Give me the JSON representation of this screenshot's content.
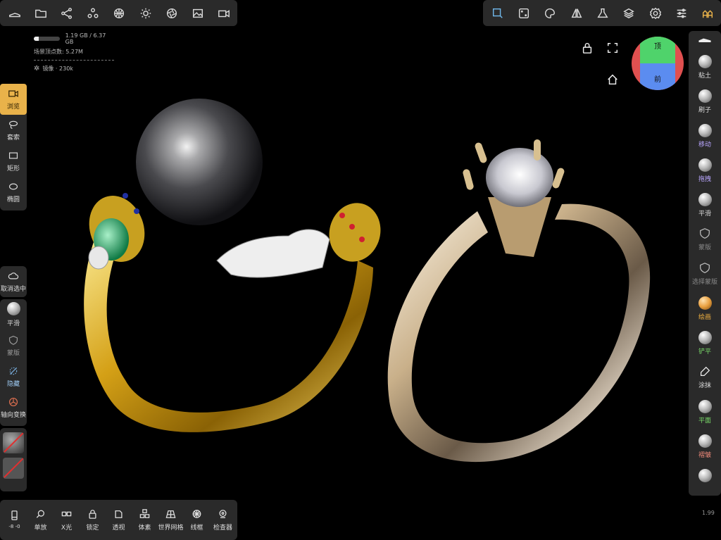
{
  "top_toolbar": {
    "icons": [
      "shoe-icon",
      "folder-icon",
      "share-nodes-icon",
      "molecule-icon",
      "sphere-grid-icon",
      "sun-icon",
      "aperture-icon",
      "image-icon",
      "video-icon"
    ]
  },
  "top_right_toolbar": {
    "icons": [
      "camera-cube-icon",
      "dice-icon",
      "palette-icon",
      "mirror-triangle-icon",
      "flask-icon",
      "layers-icon",
      "gear-icon",
      "sliders-icon",
      "app-logo-icon"
    ],
    "accent": "#e9b24a"
  },
  "stats": {
    "memory": "1.19 GB / 6.37 GB",
    "memory_fraction": 0.19,
    "vertices": "场景顶点数: 5.27M",
    "mirror": "镜像 · 230k"
  },
  "left_tools": [
    {
      "label": "浏览",
      "icon": "video-icon",
      "active": true
    },
    {
      "label": "套索",
      "icon": "lasso-icon"
    },
    {
      "label": "矩形",
      "icon": "rectangle-icon"
    },
    {
      "label": "椭圆",
      "icon": "ellipse-icon"
    }
  ],
  "left_deselect": {
    "label": "取消选中"
  },
  "left_tools2": [
    {
      "label": "平滑",
      "icon": "smooth-ball-icon"
    },
    {
      "label": "蒙版",
      "icon": "mask-shield-icon"
    },
    {
      "label": "隐藏",
      "icon": "hide-icon"
    },
    {
      "label": "轴向变换",
      "icon": "axis-transform-icon"
    }
  ],
  "bottom_toolbar": [
    {
      "label": "-8 -0",
      "icon": "phone-icon"
    },
    {
      "label": "单放",
      "icon": "search-icon"
    },
    {
      "label": "X光",
      "icon": "glasses-icon"
    },
    {
      "label": "锁定",
      "icon": "lock-icon"
    },
    {
      "label": "透视",
      "icon": "perspective-icon"
    },
    {
      "label": "体素",
      "icon": "voxel-icon"
    },
    {
      "label": "世界网格",
      "icon": "world-grid-icon"
    },
    {
      "label": "线框",
      "icon": "wireframe-icon"
    },
    {
      "label": "检查器",
      "icon": "inspector-icon"
    }
  ],
  "right_brushes": [
    {
      "label": "粘土",
      "color": "#dddddd"
    },
    {
      "label": "刷子",
      "color": "#dddddd"
    },
    {
      "label": "移动",
      "color": "#b9a6ff"
    },
    {
      "label": "拖拽",
      "color": "#b9a6ff"
    },
    {
      "label": "平滑",
      "color": "#dddddd"
    },
    {
      "label": "蒙版",
      "color": "#888888"
    },
    {
      "label": "选择蒙版",
      "color": "#888888"
    },
    {
      "label": "绘画",
      "color": "#f0b040"
    },
    {
      "label": "铲平",
      "color": "#7adc6a"
    },
    {
      "label": "涂抹",
      "color": "#dddddd"
    },
    {
      "label": "平面",
      "color": "#7adc6a"
    },
    {
      "label": "褶皱",
      "color": "#f08a7a"
    }
  ],
  "viewcube": {
    "top": "顶",
    "front": "前",
    "top_color": "#4fd36b",
    "front_color": "#5b8cf0",
    "side_color": "#e05050"
  },
  "version": "1.99"
}
